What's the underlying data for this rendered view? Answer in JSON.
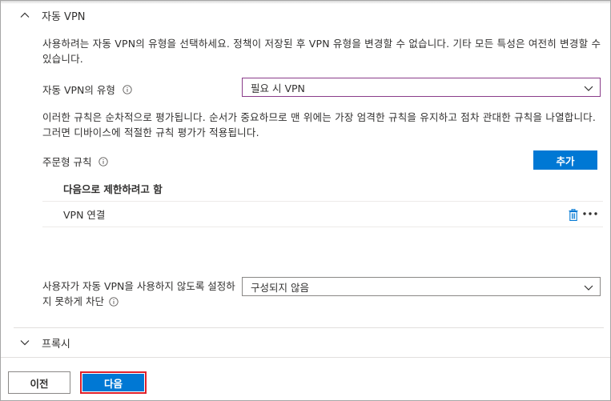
{
  "auto_vpn_section": {
    "title": "자동 VPN",
    "intro": "사용하려는 자동 VPN의 유형을 선택하세요. 정책이 저장된 후 VPN 유형을 변경할 수 없습니다. 기타 모든 특성은 여전히 변경할 수 있습니다.",
    "type_label": "자동 VPN의 유형",
    "type_value": "필요 시 VPN",
    "rules_description": "이러한 규칙은 순차적으로 평가됩니다. 순서가 중요하므로 맨 위에는 가장 엄격한 규칙을 유지하고 점차 관대한 규칙을 나열합니다. 그러면 디바이스에 적절한 규칙 평가가 적용됩니다.",
    "on_demand_rules_label": "주문형 규칙",
    "add_button": "추가",
    "rules_table": {
      "header": "다음으로 제한하려고 함",
      "rows": [
        "VPN 연결"
      ]
    },
    "block_disable_label": "사용자가 자동 VPN을 사용하지 않도록 설정하지 못하게 차단",
    "block_disable_value": "구성되지 않음"
  },
  "proxy_section": {
    "title": "프록시"
  },
  "footer": {
    "prev_button": "이전",
    "next_button": "다음"
  },
  "colors": {
    "primary": "#0078d4",
    "highlight_border": "#e0202a",
    "active_dropdown_border": "#8a3c8a"
  },
  "icons": {
    "collapse": "chevron-up-icon",
    "expand": "chevron-down-icon",
    "info": "info-icon",
    "delete": "trash-icon",
    "more": "more-icon"
  }
}
